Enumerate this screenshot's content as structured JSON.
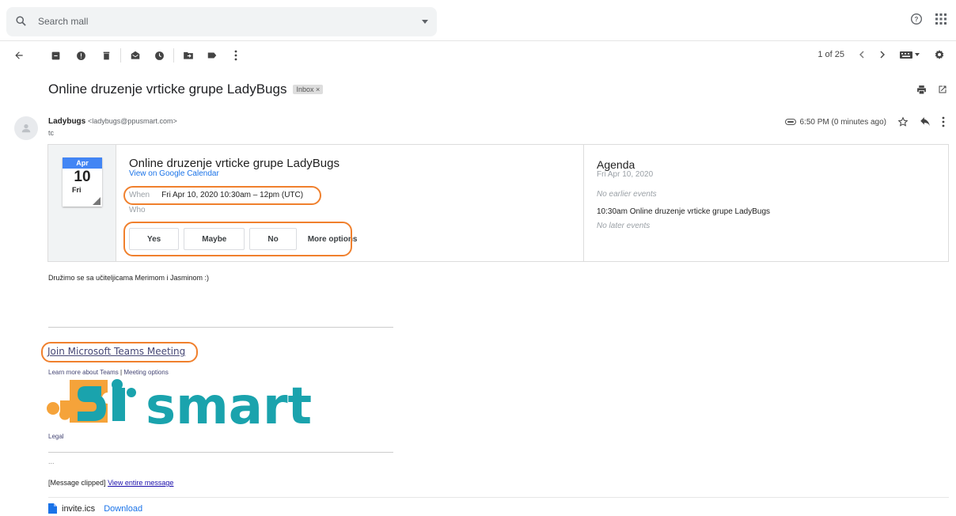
{
  "search": {
    "placeholder": "Search mall"
  },
  "toolbar": {
    "pager_text": "1 of 25"
  },
  "message": {
    "subject": "Online druzenje vrticke grupe LadyBugs",
    "label": "Inbox ×",
    "sender_name": "Ladybugs",
    "sender_email": "<ladybugs@ppusmart.com>",
    "to": "tc",
    "time": "6:50 PM (0 minutes ago)"
  },
  "invite": {
    "month": "Apr",
    "day": "10",
    "weekday": "Fri",
    "title": "Online druzenje vrticke grupe LadyBugs",
    "calendar_link": "View on Google Calendar",
    "when_label": "When",
    "when_value": "Fri Apr 10, 2020 10:30am – 12pm (UTC)",
    "who_label": "Who",
    "rsvp": {
      "yes": "Yes",
      "maybe": "Maybe",
      "no": "No",
      "more": "More options"
    }
  },
  "agenda": {
    "title": "Agenda",
    "date": "Fri Apr 10, 2020",
    "no_earlier": "No earlier events",
    "event": "10:30am  Online druzenje vrticke grupe LadyBugs",
    "no_later": "No later events"
  },
  "body": {
    "text": "Družimo se sa učiteljicama Merimom i Jasminom :)",
    "join_link": "Join Microsoft Teams Meeting",
    "learn_more": "Learn more about Teams",
    "meeting_options": "Meeting options",
    "logo_text": "smart",
    "legal": "Legal",
    "ellipsis": "...",
    "clipped_label": "[Message clipped]",
    "view_entire": "View entire message"
  },
  "attachment": {
    "name": "invite.ics",
    "download": "Download"
  },
  "colors": {
    "accent": "#1a73e8",
    "highlight": "#f0802d",
    "logo_orange": "#f5a33a",
    "logo_teal": "#1aa3ad"
  }
}
